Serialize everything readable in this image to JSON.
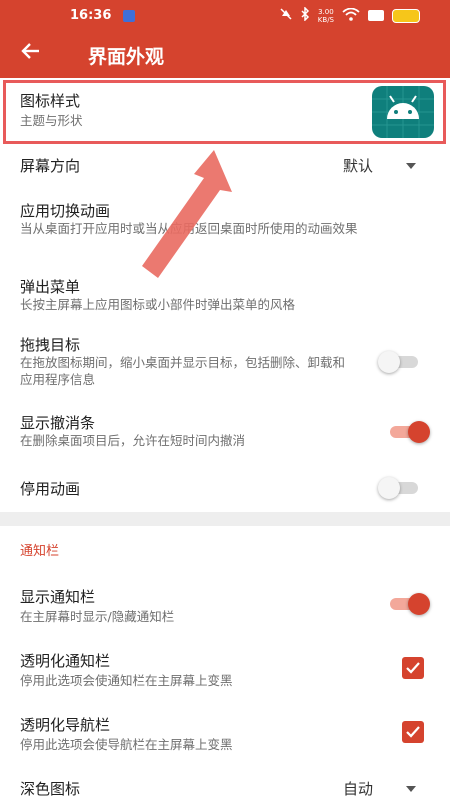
{
  "status_bar": {
    "time": "16:36",
    "speed_top": "3.00",
    "speed_bottom": "KB/S",
    "icons": [
      "notification-app-icon",
      "mute-icon",
      "bluetooth-icon",
      "wifi-icon",
      "battery-icon"
    ]
  },
  "header": {
    "back_icon": "arrow-left-icon",
    "title": "界面外观"
  },
  "settings": {
    "icon_style": {
      "label": "图标样式",
      "sub": "主题与形状"
    },
    "orientation": {
      "label": "屏幕方向",
      "value": "默认"
    },
    "transition": {
      "label": "应用切换动画",
      "sub": "当从桌面打开应用时或当从应用返回桌面时所使用的动画效果"
    },
    "popup_menu": {
      "label": "弹出菜单",
      "sub": "长按主屏幕上应用图标或小部件时弹出菜单的风格"
    },
    "drag_target": {
      "label": "拖拽目标",
      "sub": "在拖放图标期间，缩小桌面并显示目标，包括删除、卸载和应用程序信息",
      "checked": false
    },
    "undo_bar": {
      "label": "显示撤消条",
      "sub": "在删除桌面项目后，允许在短时间内撤消",
      "checked": true
    },
    "disable_anim": {
      "label": "停用动画",
      "checked": false
    }
  },
  "notification_section": {
    "header": "通知栏",
    "show_bar": {
      "label": "显示通知栏",
      "sub": "在主屏幕时显示/隐藏通知栏",
      "checked": true
    },
    "transparent_notif": {
      "label": "透明化通知栏",
      "sub": "停用此选项会使通知栏在主屏幕上变黑",
      "checked": true
    },
    "transparent_nav": {
      "label": "透明化导航栏",
      "sub": "停用此选项会使导航栏在主屏幕上变黑",
      "checked": true
    },
    "dark_icons": {
      "label": "深色图标",
      "value": "自动"
    }
  },
  "colors": {
    "accent": "#d5432e",
    "annotation_red": "#e85a5a",
    "icon_bg": "#0f7f7c"
  }
}
